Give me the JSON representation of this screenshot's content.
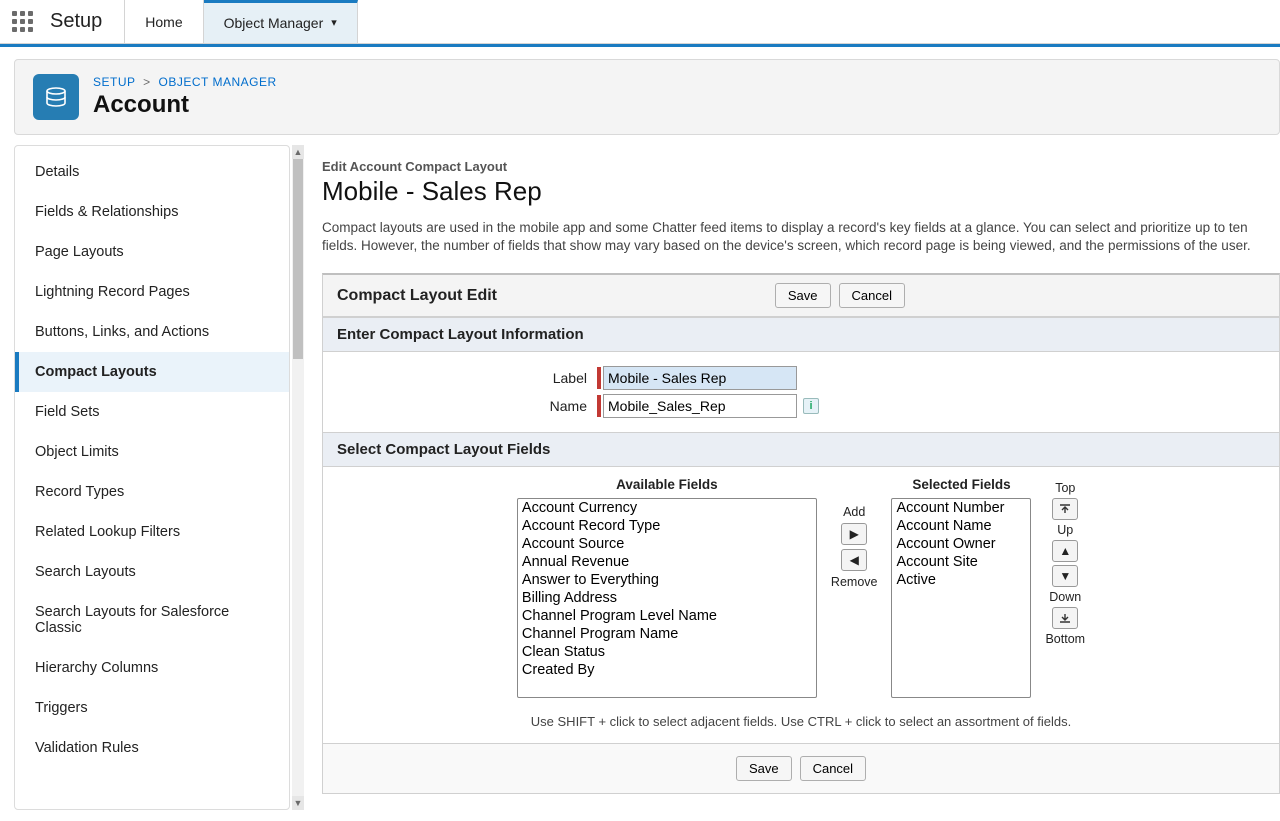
{
  "nav": {
    "brand": "Setup",
    "home": "Home",
    "object_manager": "Object Manager"
  },
  "header": {
    "bc_setup": "SETUP",
    "bc_sep": ">",
    "bc_objmgr": "OBJECT MANAGER",
    "title": "Account"
  },
  "sidebar": {
    "items": [
      "Details",
      "Fields & Relationships",
      "Page Layouts",
      "Lightning Record Pages",
      "Buttons, Links, and Actions",
      "Compact Layouts",
      "Field Sets",
      "Object Limits",
      "Record Types",
      "Related Lookup Filters",
      "Search Layouts",
      "Search Layouts for Salesforce Classic",
      "Hierarchy Columns",
      "Triggers",
      "Validation Rules"
    ],
    "active_index": 5
  },
  "main": {
    "eyebrow": "Edit Account Compact Layout",
    "title": "Mobile - Sales Rep",
    "description": "Compact layouts are used in the mobile app and some Chatter feed items to display a record's key fields at a glance. You can select and prioritize up to ten fields. However, the number of fields that show may vary based on the device's screen, which record page is being viewed, and the permissions of the user.",
    "form_title": "Compact Layout Edit",
    "save": "Save",
    "cancel": "Cancel",
    "section_info": "Enter Compact Layout Information",
    "label_label": "Label",
    "label_value": "Mobile - Sales Rep",
    "name_label": "Name",
    "name_value": "Mobile_Sales_Rep",
    "section_fields": "Select Compact Layout Fields",
    "available_label": "Available Fields",
    "selected_label": "Selected Fields",
    "add": "Add",
    "remove": "Remove",
    "top": "Top",
    "up": "Up",
    "down": "Down",
    "bottom": "Bottom",
    "available": [
      "Account Currency",
      "Account Record Type",
      "Account Source",
      "Annual Revenue",
      "Answer to Everything",
      "Billing Address",
      "Channel Program Level Name",
      "Channel Program Name",
      "Clean Status",
      "Created By"
    ],
    "selected": [
      "Account Number",
      "Account Name",
      "Account Owner",
      "Account Site",
      "Active"
    ],
    "hint": "Use SHIFT + click to select adjacent fields. Use CTRL + click to select an assortment of fields."
  }
}
